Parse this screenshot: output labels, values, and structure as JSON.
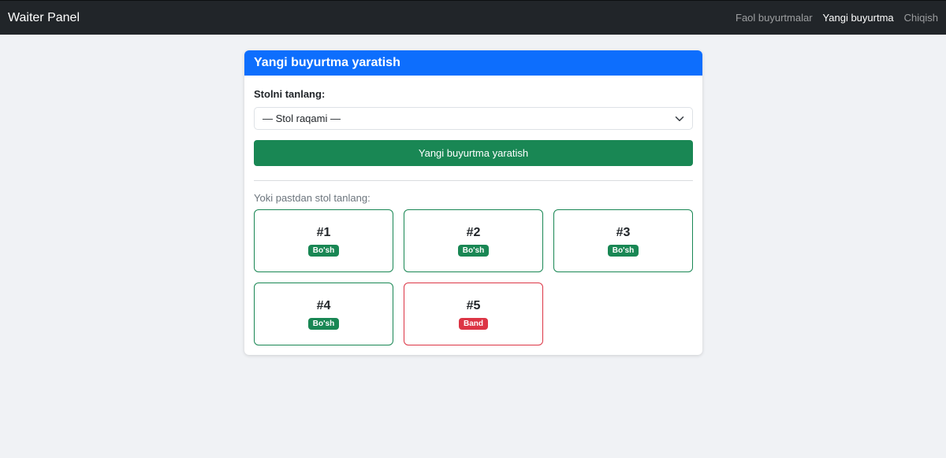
{
  "navbar": {
    "brand": "Waiter Panel",
    "links": [
      {
        "label": "Faol buyurtmalar",
        "active": false
      },
      {
        "label": "Yangi buyurtma",
        "active": true
      },
      {
        "label": "Chiqish",
        "active": false
      }
    ]
  },
  "card": {
    "title": "Yangi buyurtma yaratish",
    "select_label": "Stolni tanlang:",
    "select_value": "— Stol raqami —",
    "create_button": "Yangi buyurtma yaratish",
    "hint": "Yoki pastdan stol tanlang:"
  },
  "tables": [
    {
      "number": "#1",
      "status": "Bo'sh",
      "state": "free"
    },
    {
      "number": "#2",
      "status": "Bo'sh",
      "state": "free"
    },
    {
      "number": "#3",
      "status": "Bo'sh",
      "state": "free"
    },
    {
      "number": "#4",
      "status": "Bo'sh",
      "state": "free"
    },
    {
      "number": "#5",
      "status": "Band",
      "state": "busy"
    }
  ],
  "icons": {
    "select_arrow": "chevron-down-icon"
  },
  "colors": {
    "navbar": "#212529",
    "header": "#0d6efd",
    "success": "#198754",
    "danger": "#dc3545",
    "background": "#f0f2f5"
  }
}
